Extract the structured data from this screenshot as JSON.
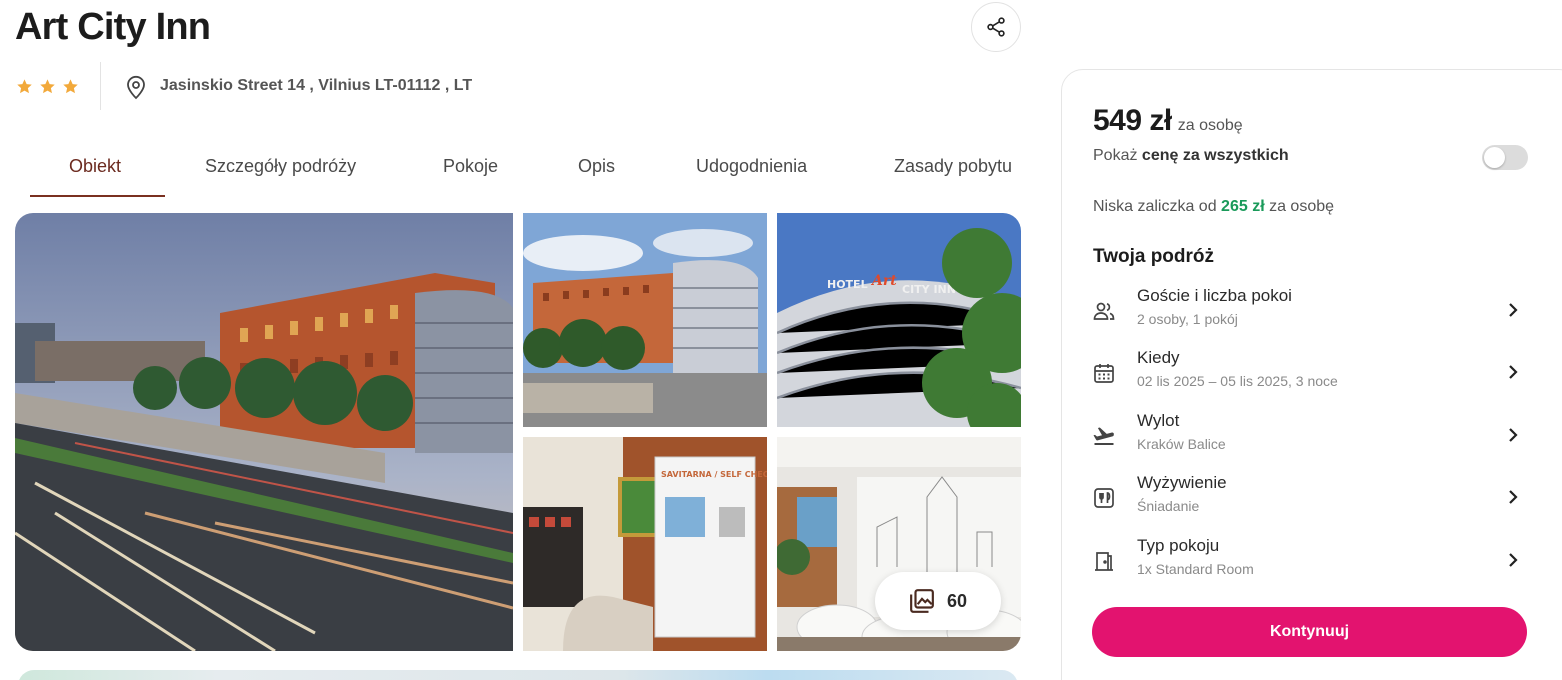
{
  "hotel": {
    "name": "Art City Inn",
    "stars": 3,
    "address": "Jasinskio Street 14 , Vilnius LT-01112 , LT"
  },
  "tabs": [
    {
      "label": "Obiekt",
      "active": true
    },
    {
      "label": "Szczegóły podróży",
      "active": false
    },
    {
      "label": "Pokoje",
      "active": false
    },
    {
      "label": "Opis",
      "active": false
    },
    {
      "label": "Udogodnienia",
      "active": false
    },
    {
      "label": "Zasady pobytu",
      "active": false
    }
  ],
  "gallery": {
    "photo_count": "60",
    "photos": [
      "hotel-exterior-highway",
      "hotel-exterior-day",
      "hotel-sign-facade",
      "lobby-self-check-in",
      "lobby-lounge"
    ]
  },
  "booking": {
    "price": "549 zł",
    "price_unit": "za osobę",
    "toggle_prefix": "Pokaż ",
    "toggle_bold": "cenę za wszystkich",
    "toggle_on": false,
    "deposit_prefix": "Niska zaliczka od ",
    "deposit_amount": "265 zł",
    "deposit_suffix": " za osobę",
    "trip_heading": "Twoja podróż",
    "trip_items": [
      {
        "icon": "guests-icon",
        "label": "Goście i liczba pokoi",
        "value": "2 osoby, 1 pokój"
      },
      {
        "icon": "calendar-icon",
        "label": "Kiedy",
        "value": "02 lis 2025 – 05 lis 2025, 3 noce"
      },
      {
        "icon": "plane-departure-icon",
        "label": "Wylot",
        "value": "Kraków Balice"
      },
      {
        "icon": "meal-icon",
        "label": "Wyżywienie",
        "value": "Śniadanie"
      },
      {
        "icon": "door-icon",
        "label": "Typ pokoju",
        "value": "1x Standard Room"
      }
    ],
    "cta_label": "Kontynuuj"
  },
  "colors": {
    "accent_pink": "#e3136f",
    "tab_active": "#6b2a1f",
    "star": "#f2a93b",
    "deposit_green": "#1a9a5a"
  }
}
